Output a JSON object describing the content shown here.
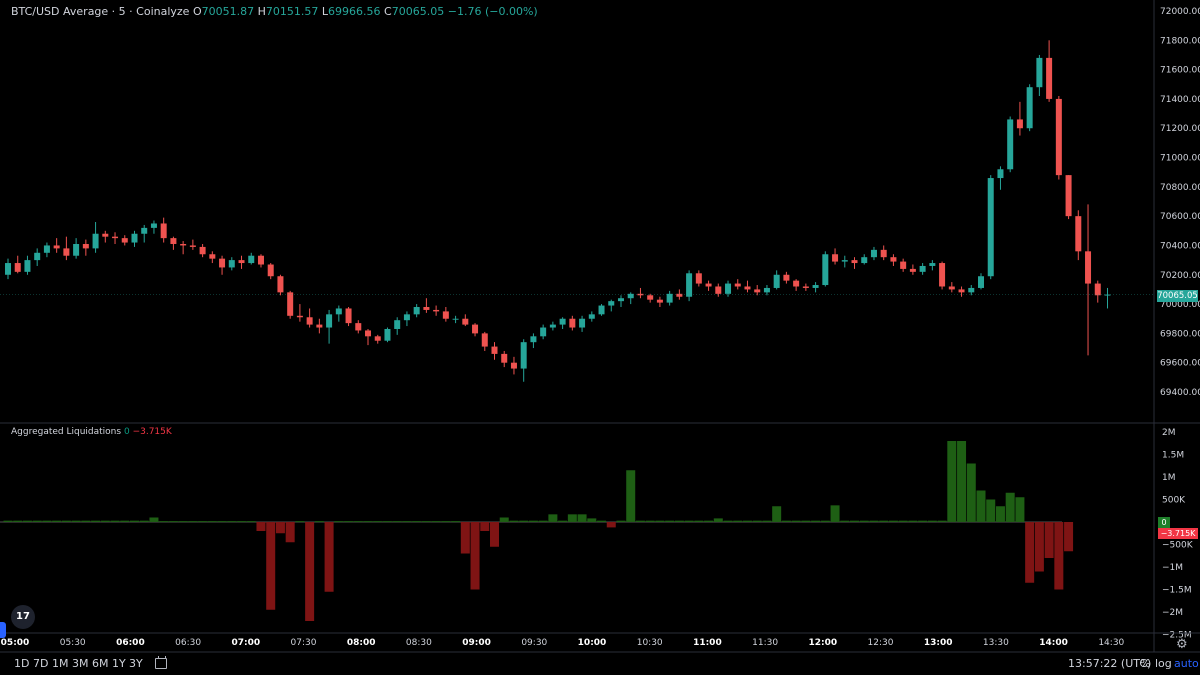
{
  "legend": {
    "symbol": "BTC/USD Average · 5 · Coinalyze",
    "o_label": "O",
    "o": "70051.87",
    "h_label": "H",
    "h": "70151.57",
    "l_label": "L",
    "l": "69966.56",
    "c_label": "C",
    "c": "70065.05",
    "change": "−1.76 (−0.00%)"
  },
  "liq_legend": {
    "title": "Aggregated Liquidations",
    "long": "0",
    "short": "−3.715K"
  },
  "price_badge": "70065.05",
  "liq_badge_zero": "0",
  "liq_badge_neg": "−3.715K",
  "colors": {
    "up": "#26a69a",
    "down": "#ef5350",
    "liq_long": "#1e5f14",
    "liq_short": "#7f1414",
    "background": "#000000"
  },
  "price_axis": [
    "72000.00",
    "71800.00",
    "71600.00",
    "71400.00",
    "71200.00",
    "71000.00",
    "70800.00",
    "70600.00",
    "70400.00",
    "70200.00",
    "70000.00",
    "69800.00",
    "69600.00",
    "69400.00"
  ],
  "liq_axis": [
    "2M",
    "1.5M",
    "1M",
    "500K",
    "−500K",
    "−1M",
    "−1.5M",
    "−2M",
    "−2.5M"
  ],
  "time_axis": [
    {
      "t": "05:00",
      "bold": true
    },
    {
      "t": "05:30",
      "bold": false
    },
    {
      "t": "06:00",
      "bold": true
    },
    {
      "t": "06:30",
      "bold": false
    },
    {
      "t": "07:00",
      "bold": true
    },
    {
      "t": "07:30",
      "bold": false
    },
    {
      "t": "08:00",
      "bold": true
    },
    {
      "t": "08:30",
      "bold": false
    },
    {
      "t": "09:00",
      "bold": true
    },
    {
      "t": "09:30",
      "bold": false
    },
    {
      "t": "10:00",
      "bold": true
    },
    {
      "t": "10:30",
      "bold": false
    },
    {
      "t": "11:00",
      "bold": true
    },
    {
      "t": "11:30",
      "bold": false
    },
    {
      "t": "12:00",
      "bold": true
    },
    {
      "t": "12:30",
      "bold": false
    },
    {
      "t": "13:00",
      "bold": true
    },
    {
      "t": "13:30",
      "bold": false
    },
    {
      "t": "14:00",
      "bold": true
    },
    {
      "t": "14:30",
      "bold": false
    }
  ],
  "toolbar": {
    "ranges": [
      "1D",
      "7D",
      "1M",
      "3M",
      "6M",
      "1Y",
      "3Y"
    ],
    "calendar_icon": "calendar-icon",
    "clock": "13:57:22 (UTC)",
    "percent": "%",
    "log": "log",
    "auto": "auto",
    "settings_icon": "gear-icon"
  },
  "logo_text": "17",
  "chart_data": {
    "type": "candlestick",
    "symbol": "BTC/USD Average",
    "interval": "5",
    "ylim": [
      69300,
      72100
    ],
    "liq_ylim": [
      -2600000,
      2200000
    ],
    "candles": [
      [
        70200,
        70310,
        70170,
        70280
      ],
      [
        70280,
        70330,
        70210,
        70220
      ],
      [
        70220,
        70330,
        70200,
        70300
      ],
      [
        70300,
        70380,
        70260,
        70350
      ],
      [
        70350,
        70420,
        70320,
        70400
      ],
      [
        70400,
        70450,
        70350,
        70380
      ],
      [
        70380,
        70460,
        70300,
        70330
      ],
      [
        70330,
        70450,
        70310,
        70410
      ],
      [
        70410,
        70440,
        70330,
        70380
      ],
      [
        70380,
        70560,
        70350,
        70480
      ],
      [
        70480,
        70500,
        70420,
        70460
      ],
      [
        70460,
        70490,
        70410,
        70450
      ],
      [
        70450,
        70470,
        70400,
        70420
      ],
      [
        70420,
        70500,
        70390,
        70480
      ],
      [
        70480,
        70540,
        70420,
        70520
      ],
      [
        70520,
        70570,
        70480,
        70550
      ],
      [
        70550,
        70590,
        70420,
        70450
      ],
      [
        70450,
        70460,
        70370,
        70410
      ],
      [
        70410,
        70430,
        70340,
        70400
      ],
      [
        70400,
        70440,
        70370,
        70390
      ],
      [
        70390,
        70410,
        70320,
        70340
      ],
      [
        70340,
        70360,
        70280,
        70310
      ],
      [
        70310,
        70330,
        70200,
        70250
      ],
      [
        70250,
        70320,
        70230,
        70300
      ],
      [
        70300,
        70330,
        70240,
        70280
      ],
      [
        70280,
        70350,
        70270,
        70330
      ],
      [
        70330,
        70340,
        70250,
        70270
      ],
      [
        70270,
        70280,
        70170,
        70190
      ],
      [
        70190,
        70200,
        70060,
        70080
      ],
      [
        70080,
        70090,
        69900,
        69920
      ],
      [
        69920,
        70000,
        69880,
        69910
      ],
      [
        69910,
        69970,
        69840,
        69860
      ],
      [
        69860,
        69900,
        69800,
        69840
      ],
      [
        69840,
        69960,
        69730,
        69930
      ],
      [
        69930,
        69990,
        69880,
        69970
      ],
      [
        69970,
        69980,
        69850,
        69870
      ],
      [
        69870,
        69890,
        69800,
        69820
      ],
      [
        69820,
        69830,
        69720,
        69780
      ],
      [
        69780,
        69790,
        69730,
        69750
      ],
      [
        69750,
        69840,
        69740,
        69830
      ],
      [
        69830,
        69910,
        69790,
        69890
      ],
      [
        69890,
        69950,
        69850,
        69930
      ],
      [
        69930,
        70000,
        69910,
        69980
      ],
      [
        69980,
        70040,
        69940,
        69960
      ],
      [
        69960,
        69990,
        69920,
        69950
      ],
      [
        69950,
        69980,
        69880,
        69900
      ],
      [
        69900,
        69920,
        69870,
        69900
      ],
      [
        69900,
        69930,
        69850,
        69860
      ],
      [
        69860,
        69870,
        69780,
        69800
      ],
      [
        69800,
        69810,
        69680,
        69710
      ],
      [
        69710,
        69740,
        69620,
        69660
      ],
      [
        69660,
        69680,
        69570,
        69600
      ],
      [
        69600,
        69640,
        69520,
        69560
      ],
      [
        69560,
        69760,
        69470,
        69740
      ],
      [
        69740,
        69800,
        69700,
        69780
      ],
      [
        69780,
        69860,
        69760,
        69840
      ],
      [
        69840,
        69880,
        69820,
        69860
      ],
      [
        69860,
        69910,
        69830,
        69900
      ],
      [
        69900,
        69920,
        69820,
        69840
      ],
      [
        69840,
        69920,
        69810,
        69900
      ],
      [
        69900,
        69950,
        69880,
        69930
      ],
      [
        69930,
        70000,
        69920,
        69990
      ],
      [
        69990,
        70030,
        69950,
        70020
      ],
      [
        70020,
        70060,
        69980,
        70040
      ],
      [
        70040,
        70080,
        70000,
        70070
      ],
      [
        70070,
        70110,
        70040,
        70060
      ],
      [
        70060,
        70070,
        70010,
        70030
      ],
      [
        70030,
        70050,
        69980,
        70010
      ],
      [
        70010,
        70090,
        69990,
        70070
      ],
      [
        70070,
        70100,
        70030,
        70050
      ],
      [
        70050,
        70230,
        70020,
        70210
      ],
      [
        70210,
        70230,
        70120,
        70140
      ],
      [
        70140,
        70160,
        70090,
        70120
      ],
      [
        70120,
        70140,
        70050,
        70070
      ],
      [
        70070,
        70160,
        70050,
        70140
      ],
      [
        70140,
        70170,
        70100,
        70120
      ],
      [
        70120,
        70160,
        70080,
        70100
      ],
      [
        70100,
        70130,
        70060,
        70080
      ],
      [
        70080,
        70130,
        70060,
        70110
      ],
      [
        70110,
        70230,
        70100,
        70200
      ],
      [
        70200,
        70220,
        70140,
        70160
      ],
      [
        70160,
        70170,
        70090,
        70120
      ],
      [
        70120,
        70140,
        70090,
        70110
      ],
      [
        70110,
        70150,
        70080,
        70130
      ],
      [
        70130,
        70360,
        70120,
        70340
      ],
      [
        70340,
        70380,
        70270,
        70290
      ],
      [
        70290,
        70330,
        70250,
        70300
      ],
      [
        70300,
        70320,
        70240,
        70280
      ],
      [
        70280,
        70340,
        70270,
        70320
      ],
      [
        70320,
        70390,
        70300,
        70370
      ],
      [
        70370,
        70400,
        70300,
        70320
      ],
      [
        70320,
        70340,
        70260,
        70290
      ],
      [
        70290,
        70310,
        70220,
        70240
      ],
      [
        70240,
        70270,
        70200,
        70220
      ],
      [
        70220,
        70280,
        70200,
        70260
      ],
      [
        70260,
        70300,
        70230,
        70280
      ],
      [
        70280,
        70290,
        70100,
        70120
      ],
      [
        70120,
        70150,
        70080,
        70100
      ],
      [
        70100,
        70120,
        70050,
        70080
      ],
      [
        70080,
        70130,
        70060,
        70110
      ],
      [
        70110,
        70210,
        70100,
        70190
      ],
      [
        70190,
        70880,
        70170,
        70860
      ],
      [
        70860,
        70940,
        70780,
        70920
      ],
      [
        70920,
        71280,
        70900,
        71260
      ],
      [
        71260,
        71380,
        71150,
        71200
      ],
      [
        71200,
        71500,
        71180,
        71480
      ],
      [
        71480,
        71700,
        71420,
        71680
      ],
      [
        71680,
        71800,
        71380,
        71400
      ],
      [
        71400,
        71420,
        70850,
        70880
      ],
      [
        70880,
        70880,
        70580,
        70600
      ],
      [
        70600,
        70640,
        70300,
        70360
      ],
      [
        70360,
        70680,
        69650,
        70140
      ],
      [
        70140,
        70160,
        70010,
        70060
      ],
      [
        70060,
        70110,
        69970,
        70065
      ]
    ],
    "liquidations": [
      30000,
      30000,
      30000,
      30000,
      30000,
      30000,
      30000,
      30000,
      30000,
      30000,
      30000,
      30000,
      30000,
      30000,
      30000,
      100000,
      20000,
      20000,
      20000,
      20000,
      20000,
      20000,
      20000,
      20000,
      20000,
      20000,
      -200000,
      -1950000,
      -250000,
      -450000,
      20000,
      -2200000,
      20000,
      -1550000,
      20000,
      20000,
      20000,
      20000,
      20000,
      20000,
      20000,
      20000,
      20000,
      20000,
      20000,
      20000,
      20000,
      -700000,
      -1500000,
      -200000,
      -550000,
      100000,
      30000,
      30000,
      30000,
      30000,
      170000,
      30000,
      170000,
      170000,
      80000,
      30000,
      -120000,
      30000,
      1150000,
      30000,
      30000,
      30000,
      30000,
      30000,
      30000,
      30000,
      30000,
      80000,
      30000,
      30000,
      30000,
      30000,
      30000,
      350000,
      30000,
      30000,
      30000,
      30000,
      30000,
      370000,
      30000,
      30000,
      30000,
      30000,
      30000,
      30000,
      30000,
      30000,
      30000,
      30000,
      30000,
      1800000,
      1800000,
      1300000,
      700000,
      500000,
      350000,
      650000,
      550000,
      -1350000,
      -1100000,
      -800000,
      -1500000,
      -650000
    ]
  }
}
